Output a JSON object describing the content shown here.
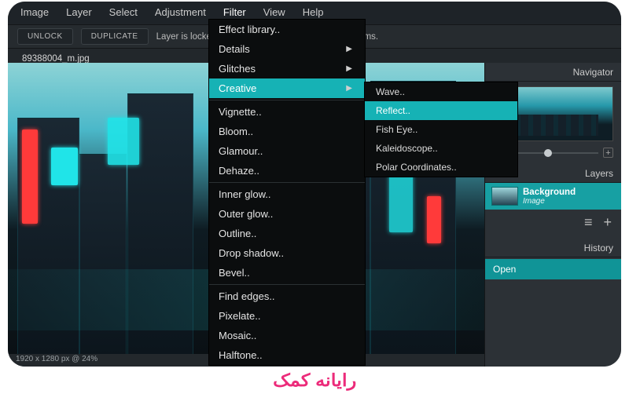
{
  "menubar": {
    "items": [
      "Image",
      "Layer",
      "Select",
      "Adjustment",
      "Filter",
      "View",
      "Help"
    ],
    "active_index": 4
  },
  "toolbar": {
    "unlock": "UNLOCK",
    "duplicate": "DUPLICATE",
    "message": "Layer is locked in position, unlock to enable transforms."
  },
  "tab": {
    "filename": "89388004_m.jpg"
  },
  "filter_menu": {
    "items": [
      {
        "label": "Effect library..",
        "arrow": false
      },
      {
        "label": "Details",
        "arrow": true
      },
      {
        "label": "Glitches",
        "arrow": true
      },
      {
        "label": "Creative",
        "arrow": true,
        "highlight": true
      },
      {
        "label": "Vignette..",
        "arrow": false,
        "sep_before": true
      },
      {
        "label": "Bloom..",
        "arrow": false
      },
      {
        "label": "Glamour..",
        "arrow": false
      },
      {
        "label": "Dehaze..",
        "arrow": false
      },
      {
        "label": "Inner glow..",
        "arrow": false,
        "sep_before": true
      },
      {
        "label": "Outer glow..",
        "arrow": false
      },
      {
        "label": "Outline..",
        "arrow": false
      },
      {
        "label": "Drop shadow..",
        "arrow": false
      },
      {
        "label": "Bevel..",
        "arrow": false
      },
      {
        "label": "Find edges..",
        "arrow": false,
        "sep_before": true
      },
      {
        "label": "Pixelate..",
        "arrow": false
      },
      {
        "label": "Mosaic..",
        "arrow": false
      },
      {
        "label": "Halftone..",
        "arrow": false
      }
    ]
  },
  "creative_submenu": {
    "items": [
      {
        "label": "Wave.."
      },
      {
        "label": "Reflect..",
        "highlight": true
      },
      {
        "label": "Fish Eye.."
      },
      {
        "label": "Kaleidoscope.."
      },
      {
        "label": "Polar Coordinates.."
      }
    ]
  },
  "right": {
    "navigator_title": "Navigator",
    "layers_title": "Layers",
    "layer": {
      "name": "Background",
      "kind": "Image"
    },
    "history_title": "History",
    "history_item": "Open",
    "minus": "−",
    "plus": "+"
  },
  "statusbar": "1920 x 1280 px @ 24%",
  "canvas_colors": {
    "sign_red": "#ff3a3a",
    "sign_cyan": "#20e4e8",
    "sign_orange": "#ffb54a",
    "sign_white": "#f1f6f6"
  },
  "brand": "رایانه کمک"
}
